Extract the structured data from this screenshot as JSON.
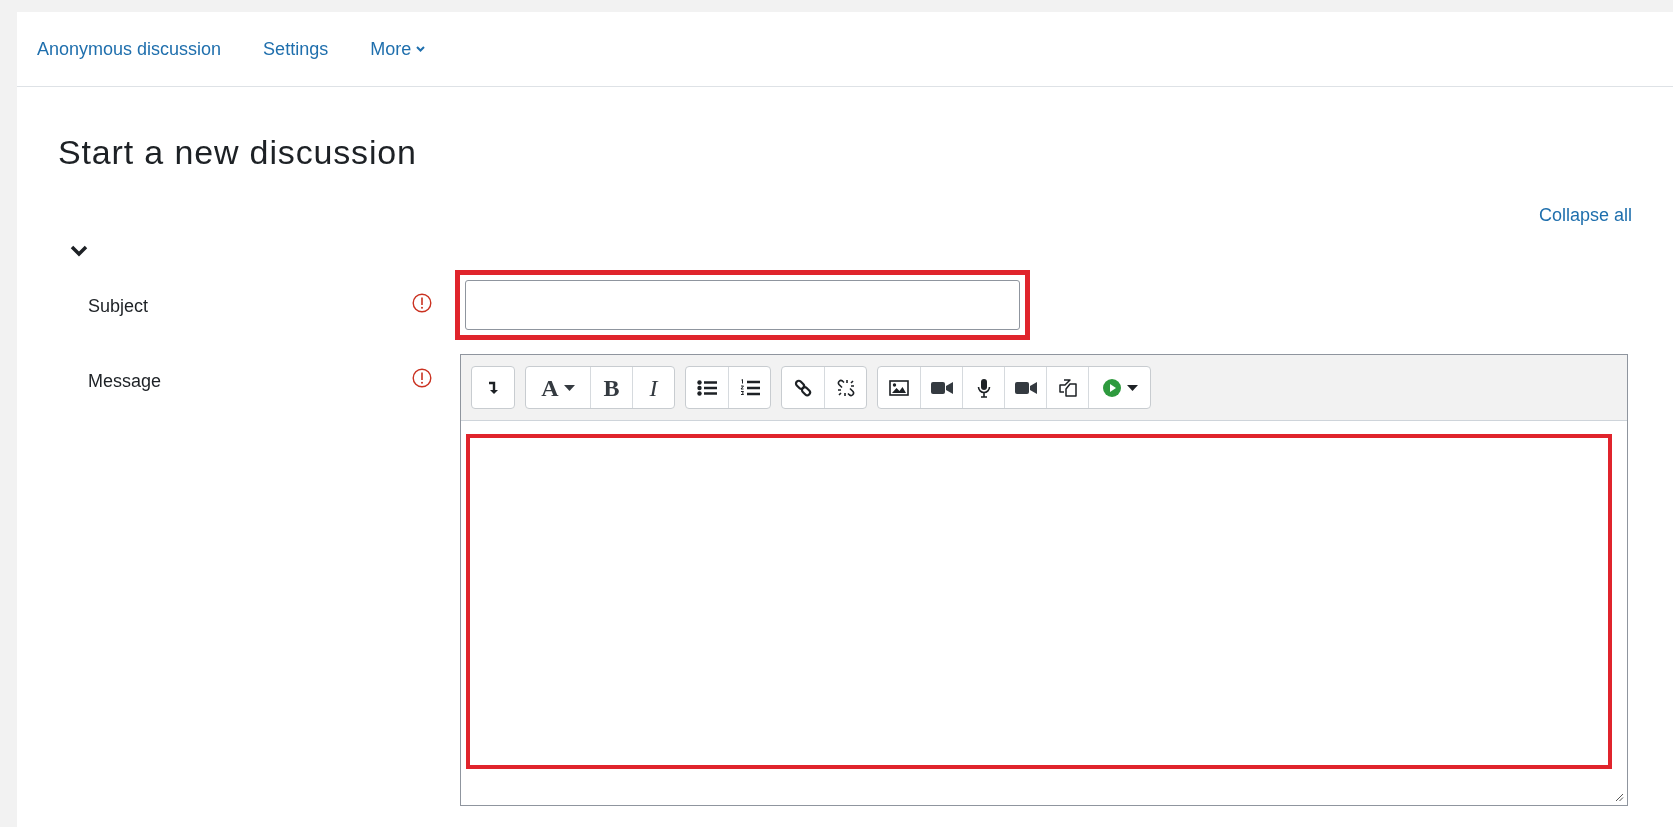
{
  "nav": [
    {
      "label": "Anonymous discussion",
      "kind": "link"
    },
    {
      "label": "Settings",
      "kind": "link"
    },
    {
      "label": "More",
      "kind": "dropdown"
    }
  ],
  "heading": "Start a new discussion",
  "collapse_link": "Collapse all",
  "section": {
    "expanded": true
  },
  "fields": [
    {
      "label": "Subject",
      "required": true,
      "kind": "text",
      "highlighted": true
    },
    {
      "label": "Message",
      "required": true,
      "kind": "editor",
      "highlighted": true
    }
  ],
  "toolbar": [
    [
      {
        "kind": "expand"
      }
    ],
    [
      {
        "kind": "font",
        "label": "A"
      },
      {
        "kind": "bold",
        "label": "B"
      },
      {
        "kind": "italic",
        "label": "I"
      }
    ],
    [
      {
        "kind": "bullets"
      },
      {
        "kind": "numbers"
      }
    ],
    [
      {
        "kind": "link"
      },
      {
        "kind": "unlink"
      }
    ],
    [
      {
        "kind": "image"
      },
      {
        "kind": "video"
      },
      {
        "kind": "mic"
      },
      {
        "kind": "video"
      },
      {
        "kind": "copy"
      },
      {
        "kind": "media"
      }
    ]
  ]
}
